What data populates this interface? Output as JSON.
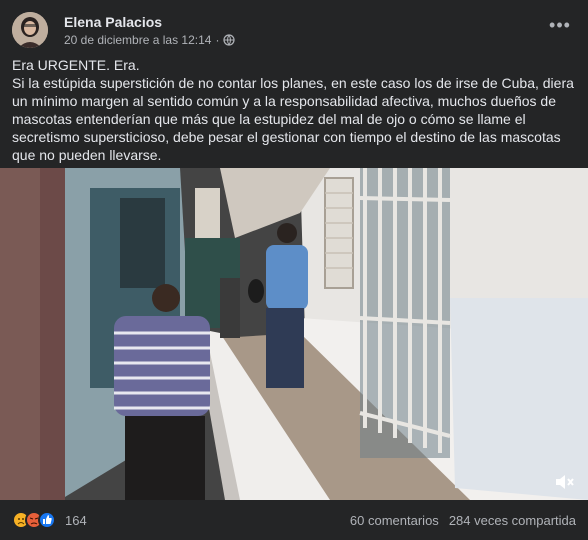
{
  "post": {
    "author": "Elena Palacios",
    "timestamp": "20 de diciembre a las 12:14",
    "privacy_icon": "globe-icon",
    "more_icon": "more-dots-icon",
    "paragraphs": [
      "Era URGENTE. Era.",
      "Si la estúpida superstición de no contar los planes, en este caso los de irse de Cuba, diera un mínimo margen al sentido común y a la responsabilidad afectiva, muchos dueños de mascotas entenderían que más que la estupidez del mal de ojo o cómo se llame el secretismo supersticioso, debe pesar el gestionar con  tiempo el destino de las mascotas que no pueden llevarse."
    ]
  },
  "video": {
    "volume_icon": "volume-icon"
  },
  "footer": {
    "reaction_icons": [
      "sad-icon",
      "angry-icon",
      "like-icon"
    ],
    "reaction_count": "164",
    "comments": "60 comentarios",
    "shares": "284 veces compartida"
  },
  "colors": {
    "background": "#242526",
    "text": "#e4e6eb",
    "secondary": "#b0b3b8"
  }
}
